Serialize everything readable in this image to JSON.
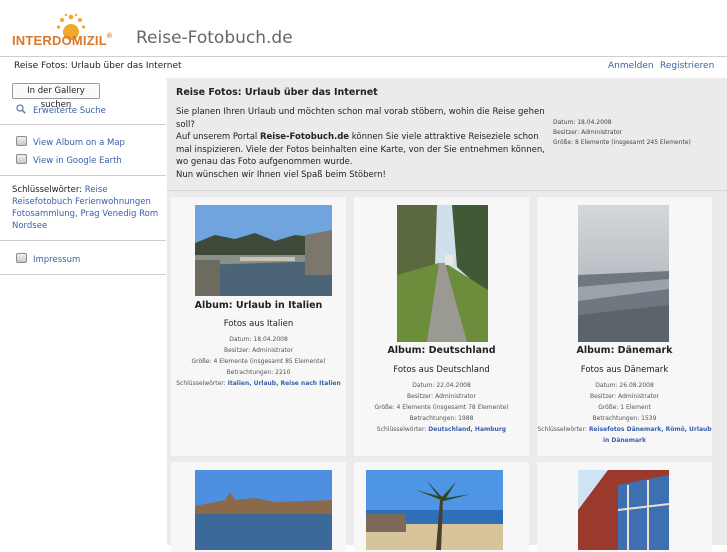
{
  "header": {
    "logo": {
      "part1": "INTER",
      "part2": "DOMIZIL",
      "reg": "®"
    },
    "site_title": "Reise-Fotobuch.de"
  },
  "nav": {
    "breadcrumb": "Reise Fotos: Urlaub über das Internet",
    "login": "Anmelden",
    "register": "Registrieren"
  },
  "sidebar": {
    "search_button": "In der Gallery suchen",
    "advanced_search": "Erweiterte Suche",
    "map_link": "View Album on a Map",
    "earth_link": "View in Google Earth",
    "keywords_label": "Schlüsselwörter:",
    "keywords": [
      "Reise",
      "Reisefotobuch",
      "Ferienwohnungen",
      "Fotosammlung,",
      "Prag",
      "Venedig",
      "Rom",
      "Nordsee"
    ],
    "impressum": "Impressum"
  },
  "intro": {
    "title": "Reise Fotos: Urlaub über das Internet",
    "line1": "Sie planen Ihren Urlaub und möchten schon mal vorab stöbern, wohin die Reise gehen soll?",
    "line2a": "Auf unserem Portal ",
    "line2b": "Reise-Fotobuch.de",
    "line2c": " können Sie viele attraktive Reiseziele schon mal inspizieren. Viele der Fotos beinhalten eine Karte, von der Sie entnehmen können, wo genau das Foto aufgenommen wurde.",
    "line3": "Nun wünschen wir Ihnen viel Spaß beim Stöbern!",
    "meta_date": "Datum: 18.04.2008",
    "meta_owner": "Besitzer: Administrator",
    "meta_size": "Größe: 8 Elemente (insgesamt 245 Elemente)"
  },
  "albums": [
    {
      "title": "Album: Urlaub in Italien",
      "subtitle": "Fotos aus Italien",
      "date": "Datum: 18.04.2008",
      "owner": "Besitzer: Administrator",
      "size": "Größe: 4 Elemente (insgesamt 85 Elemente)",
      "views": "Betrachtungen: 2210",
      "keywords_label": "Schlüsselwörter:",
      "keywords": "Italien, Urlaub, Reise nach Italien"
    },
    {
      "title": "Album: Deutschland",
      "subtitle": "Fotos aus Deutschland",
      "date": "Datum: 22.04.2008",
      "owner": "Besitzer: Administrator",
      "size": "Größe: 4 Elemente (insgesamt 78 Elemente)",
      "views": "Betrachtungen: 1988",
      "keywords_label": "Schlüsselwörter:",
      "keywords": "Deutschland, Hamburg"
    },
    {
      "title": "Album: Dänemark",
      "subtitle": "Fotos aus Dänemark",
      "date": "Datum: 26.08.2008",
      "owner": "Besitzer: Administrator",
      "size": "Größe: 1 Element",
      "views": "Betrachtungen: 1539",
      "keywords_label": "Schlüsselwörter:",
      "keywords": "Reisefotos Dänemark, Römö, Urlaub in Dänemark"
    }
  ],
  "colors": {
    "brand_orange": "#d9782a",
    "link_blue": "#3a5fa8",
    "panel_gray": "#ebebeb"
  }
}
